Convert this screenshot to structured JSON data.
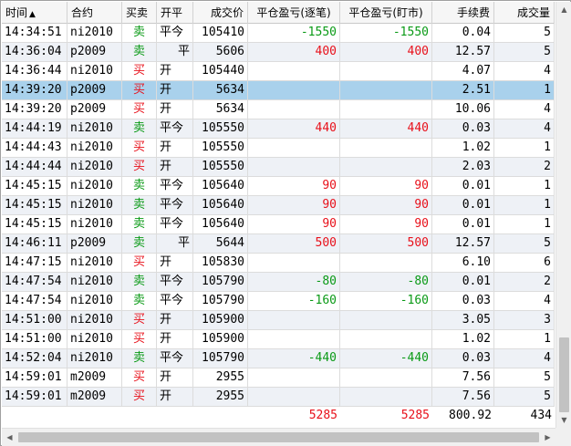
{
  "columns": [
    {
      "label": "时间",
      "sort": "▲"
    },
    {
      "label": "合约"
    },
    {
      "label": "买卖"
    },
    {
      "label": "开平"
    },
    {
      "label": "成交价"
    },
    {
      "label": "平仓盈亏(逐笔)"
    },
    {
      "label": "平仓盈亏(盯市)"
    },
    {
      "label": "手续费"
    },
    {
      "label": "成交量"
    }
  ],
  "rows": [
    {
      "time": "14:34:51",
      "contract": "ni2010",
      "side": "卖",
      "side_color": "green",
      "oc": "平今",
      "oc_align": "l",
      "price": "105410",
      "pnl_trade": "-1550",
      "pnl_trade_color": "green",
      "pnl_mark": "-1550",
      "pnl_mark_color": "green",
      "fee": "0.04",
      "volume": "5"
    },
    {
      "time": "14:36:04",
      "contract": "p2009",
      "side": "卖",
      "side_color": "green",
      "oc": "平",
      "oc_align": "r",
      "price": "5606",
      "pnl_trade": "400",
      "pnl_trade_color": "red",
      "pnl_mark": "400",
      "pnl_mark_color": "red",
      "fee": "12.57",
      "volume": "5"
    },
    {
      "time": "14:36:44",
      "contract": "ni2010",
      "side": "买",
      "side_color": "red",
      "oc": "开",
      "oc_align": "l",
      "price": "105440",
      "pnl_trade": "",
      "pnl_trade_color": "red",
      "pnl_mark": "",
      "pnl_mark_color": "red",
      "fee": "4.07",
      "volume": "4"
    },
    {
      "time": "14:39:20",
      "contract": "p2009",
      "side": "买",
      "side_color": "red",
      "oc": "开",
      "oc_align": "l",
      "price": "5634",
      "pnl_trade": "",
      "pnl_trade_color": "red",
      "pnl_mark": "",
      "pnl_mark_color": "red",
      "fee": "2.51",
      "volume": "1",
      "selected": true
    },
    {
      "time": "14:39:20",
      "contract": "p2009",
      "side": "买",
      "side_color": "red",
      "oc": "开",
      "oc_align": "l",
      "price": "5634",
      "pnl_trade": "",
      "pnl_trade_color": "red",
      "pnl_mark": "",
      "pnl_mark_color": "red",
      "fee": "10.06",
      "volume": "4"
    },
    {
      "time": "14:44:19",
      "contract": "ni2010",
      "side": "卖",
      "side_color": "green",
      "oc": "平今",
      "oc_align": "l",
      "price": "105550",
      "pnl_trade": "440",
      "pnl_trade_color": "red",
      "pnl_mark": "440",
      "pnl_mark_color": "red",
      "fee": "0.03",
      "volume": "4"
    },
    {
      "time": "14:44:43",
      "contract": "ni2010",
      "side": "买",
      "side_color": "red",
      "oc": "开",
      "oc_align": "l",
      "price": "105550",
      "pnl_trade": "",
      "pnl_trade_color": "red",
      "pnl_mark": "",
      "pnl_mark_color": "red",
      "fee": "1.02",
      "volume": "1"
    },
    {
      "time": "14:44:44",
      "contract": "ni2010",
      "side": "买",
      "side_color": "red",
      "oc": "开",
      "oc_align": "l",
      "price": "105550",
      "pnl_trade": "",
      "pnl_trade_color": "red",
      "pnl_mark": "",
      "pnl_mark_color": "red",
      "fee": "2.03",
      "volume": "2"
    },
    {
      "time": "14:45:15",
      "contract": "ni2010",
      "side": "卖",
      "side_color": "green",
      "oc": "平今",
      "oc_align": "l",
      "price": "105640",
      "pnl_trade": "90",
      "pnl_trade_color": "red",
      "pnl_mark": "90",
      "pnl_mark_color": "red",
      "fee": "0.01",
      "volume": "1"
    },
    {
      "time": "14:45:15",
      "contract": "ni2010",
      "side": "卖",
      "side_color": "green",
      "oc": "平今",
      "oc_align": "l",
      "price": "105640",
      "pnl_trade": "90",
      "pnl_trade_color": "red",
      "pnl_mark": "90",
      "pnl_mark_color": "red",
      "fee": "0.01",
      "volume": "1"
    },
    {
      "time": "14:45:15",
      "contract": "ni2010",
      "side": "卖",
      "side_color": "green",
      "oc": "平今",
      "oc_align": "l",
      "price": "105640",
      "pnl_trade": "90",
      "pnl_trade_color": "red",
      "pnl_mark": "90",
      "pnl_mark_color": "red",
      "fee": "0.01",
      "volume": "1"
    },
    {
      "time": "14:46:11",
      "contract": "p2009",
      "side": "卖",
      "side_color": "green",
      "oc": "平",
      "oc_align": "r",
      "price": "5644",
      "pnl_trade": "500",
      "pnl_trade_color": "red",
      "pnl_mark": "500",
      "pnl_mark_color": "red",
      "fee": "12.57",
      "volume": "5"
    },
    {
      "time": "14:47:15",
      "contract": "ni2010",
      "side": "买",
      "side_color": "red",
      "oc": "开",
      "oc_align": "l",
      "price": "105830",
      "pnl_trade": "",
      "pnl_trade_color": "red",
      "pnl_mark": "",
      "pnl_mark_color": "red",
      "fee": "6.10",
      "volume": "6"
    },
    {
      "time": "14:47:54",
      "contract": "ni2010",
      "side": "卖",
      "side_color": "green",
      "oc": "平今",
      "oc_align": "l",
      "price": "105790",
      "pnl_trade": "-80",
      "pnl_trade_color": "green",
      "pnl_mark": "-80",
      "pnl_mark_color": "green",
      "fee": "0.01",
      "volume": "2"
    },
    {
      "time": "14:47:54",
      "contract": "ni2010",
      "side": "卖",
      "side_color": "green",
      "oc": "平今",
      "oc_align": "l",
      "price": "105790",
      "pnl_trade": "-160",
      "pnl_trade_color": "green",
      "pnl_mark": "-160",
      "pnl_mark_color": "green",
      "fee": "0.03",
      "volume": "4"
    },
    {
      "time": "14:51:00",
      "contract": "ni2010",
      "side": "买",
      "side_color": "red",
      "oc": "开",
      "oc_align": "l",
      "price": "105900",
      "pnl_trade": "",
      "pnl_trade_color": "red",
      "pnl_mark": "",
      "pnl_mark_color": "red",
      "fee": "3.05",
      "volume": "3"
    },
    {
      "time": "14:51:00",
      "contract": "ni2010",
      "side": "买",
      "side_color": "red",
      "oc": "开",
      "oc_align": "l",
      "price": "105900",
      "pnl_trade": "",
      "pnl_trade_color": "red",
      "pnl_mark": "",
      "pnl_mark_color": "red",
      "fee": "1.02",
      "volume": "1"
    },
    {
      "time": "14:52:04",
      "contract": "ni2010",
      "side": "卖",
      "side_color": "green",
      "oc": "平今",
      "oc_align": "l",
      "price": "105790",
      "pnl_trade": "-440",
      "pnl_trade_color": "green",
      "pnl_mark": "-440",
      "pnl_mark_color": "green",
      "fee": "0.03",
      "volume": "4"
    },
    {
      "time": "14:59:01",
      "contract": "m2009",
      "side": "买",
      "side_color": "red",
      "oc": "开",
      "oc_align": "l",
      "price": "2955",
      "pnl_trade": "",
      "pnl_trade_color": "red",
      "pnl_mark": "",
      "pnl_mark_color": "red",
      "fee": "7.56",
      "volume": "5"
    },
    {
      "time": "14:59:01",
      "contract": "m2009",
      "side": "买",
      "side_color": "red",
      "oc": "开",
      "oc_align": "l",
      "price": "2955",
      "pnl_trade": "",
      "pnl_trade_color": "red",
      "pnl_mark": "",
      "pnl_mark_color": "red",
      "fee": "7.56",
      "volume": "5"
    }
  ],
  "totals": {
    "pnl_trade": "5285",
    "pnl_mark": "5285",
    "fee": "800.92",
    "volume": "434"
  },
  "colors": {
    "red": "#e8101a",
    "green": "#0a9a16",
    "selected_row": "#a9d1ec",
    "alt_row": "#eef1f6"
  },
  "icons": {
    "scroll_up": "▲",
    "scroll_down": "▼",
    "scroll_left": "◀",
    "scroll_right": "▶"
  }
}
